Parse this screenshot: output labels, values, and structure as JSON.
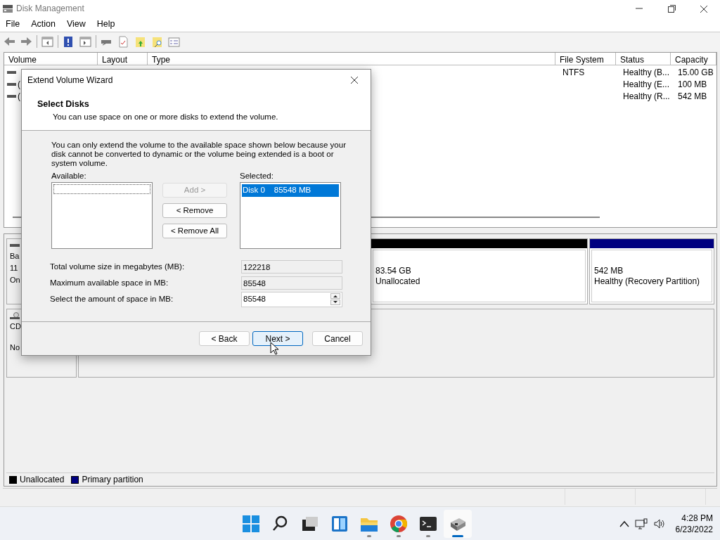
{
  "window": {
    "title": "Disk Management"
  },
  "menu": [
    "File",
    "Action",
    "View",
    "Help"
  ],
  "volume_table": {
    "columns": [
      "Volume",
      "Layout",
      "Type",
      "File System",
      "Status",
      "Capacity"
    ],
    "rows": [
      {
        "file_system": "NTFS",
        "status": "Healthy (B...",
        "capacity": "15.00 GB"
      },
      {
        "volume": "(",
        "status": "Healthy (E...",
        "capacity": "100 MB"
      },
      {
        "volume": "(",
        "status": "Healthy (R...",
        "capacity": "542 MB"
      }
    ]
  },
  "disks": [
    {
      "kind": "hdd",
      "label_lines": [
        "Ba",
        "11",
        "On"
      ],
      "partitions": [
        {
          "size": "83.54 GB",
          "status": "Unallocated",
          "color": "#000000"
        },
        {
          "size": "542 MB",
          "status": "Healthy (Recovery Partition)",
          "color": "#000080"
        }
      ]
    },
    {
      "kind": "cdrom",
      "label_lines": [
        "CD",
        "No"
      ]
    }
  ],
  "legend": [
    {
      "label": "Unallocated",
      "color": "#000000"
    },
    {
      "label": "Primary partition",
      "color": "#000080"
    }
  ],
  "dialog": {
    "title": "Extend Volume Wizard",
    "heading": "Select Disks",
    "subtitle": "You can use space on one or more disks to extend the volume.",
    "note": "You can only extend the volume to the available space shown below because your disk cannot be converted to dynamic or the volume being extended is a boot or system volume.",
    "available_label": "Available:",
    "selected_label": "Selected:",
    "move_buttons": [
      {
        "label": "Add >",
        "disabled": true
      },
      {
        "label": "< Remove",
        "disabled": false
      },
      {
        "label": "< Remove All",
        "disabled": false
      }
    ],
    "selected_items": [
      {
        "disk": "Disk 0",
        "size": "85548 MB",
        "selected": true
      }
    ],
    "fields": [
      {
        "label": "Total volume size in megabytes (MB):",
        "value": "122218",
        "kind": "readonly"
      },
      {
        "label": "Maximum available space in MB:",
        "value": "85548",
        "kind": "readonly"
      },
      {
        "label": "Select the amount of space in MB:",
        "value": "85548",
        "kind": "spin"
      }
    ],
    "footer_buttons": [
      {
        "label": "< Back",
        "default": false
      },
      {
        "label": "Next >",
        "default": true
      },
      {
        "label": "Cancel",
        "default": false
      }
    ]
  },
  "taskbar": {
    "apps": [
      {
        "kind": "start",
        "running": false,
        "active": false
      },
      {
        "kind": "search",
        "running": false,
        "active": false
      },
      {
        "kind": "taskview",
        "running": false,
        "active": false
      },
      {
        "kind": "widgets",
        "running": false,
        "active": false
      },
      {
        "kind": "explorer",
        "running": true,
        "active": false
      },
      {
        "kind": "chrome",
        "running": true,
        "active": false
      },
      {
        "kind": "terminal",
        "running": true,
        "active": false
      },
      {
        "kind": "diskmgmt",
        "running": true,
        "active": true
      }
    ],
    "time": "4:28 PM",
    "date": "6/23/2022"
  }
}
